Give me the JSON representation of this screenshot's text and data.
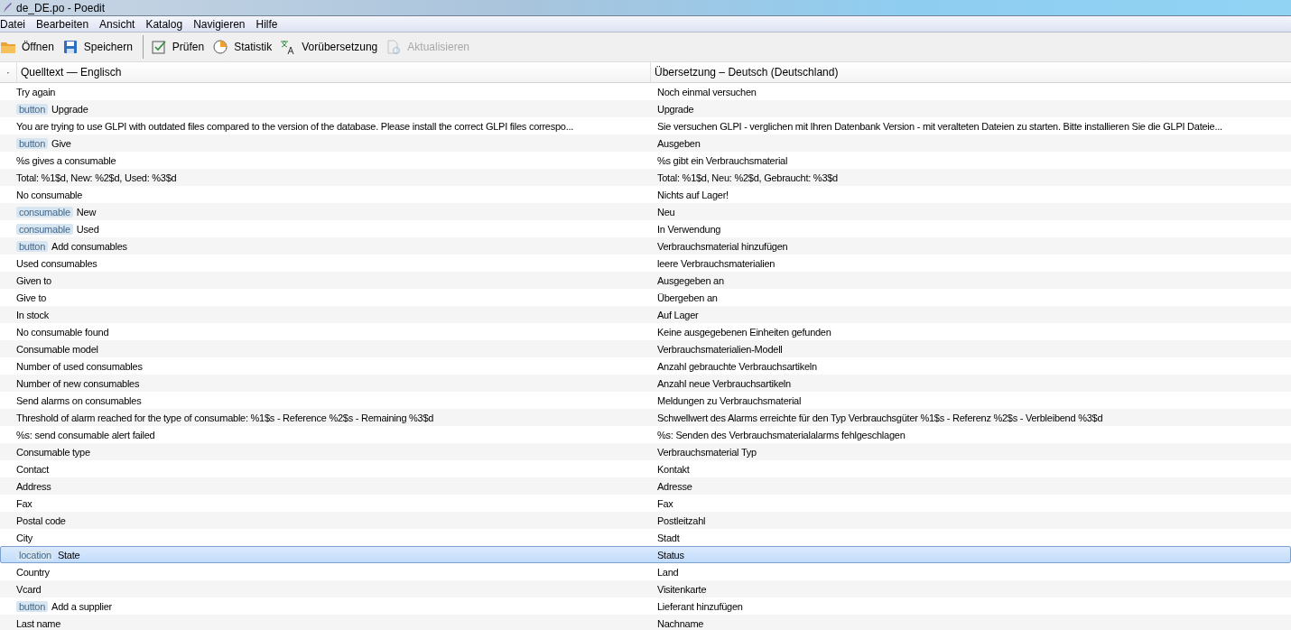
{
  "window": {
    "title": "de_DE.po - Poedit"
  },
  "menu": [
    "Datei",
    "Bearbeiten",
    "Ansicht",
    "Katalog",
    "Navigieren",
    "Hilfe"
  ],
  "toolbar": [
    {
      "kind": "open",
      "label": "Öffnen",
      "disabled": false
    },
    {
      "kind": "save",
      "label": "Speichern",
      "disabled": false
    },
    {
      "kind": "check",
      "label": "Prüfen",
      "disabled": false
    },
    {
      "kind": "stats",
      "label": "Statistik",
      "disabled": false
    },
    {
      "kind": "translate",
      "label": "Vorübersetzung",
      "disabled": false
    },
    {
      "kind": "update",
      "label": "Aktualisieren",
      "disabled": true
    }
  ],
  "table": {
    "marker": "·",
    "columns": [
      "Quelltext — Englisch",
      "Übersetzung – Deutsch (Deutschland)"
    ],
    "rows": [
      {
        "source": "Try again",
        "translation": "Noch einmal versuchen",
        "selected": false
      },
      {
        "context": "button",
        "source": "Upgrade",
        "translation": "Upgrade",
        "selected": false
      },
      {
        "source": "You are trying to use GLPI with outdated files compared to the version of the database. Please install the correct GLPI files correspo...",
        "translation": "Sie versuchen GLPI - verglichen mit Ihren Datenbank Version - mit veralteten Dateien zu starten. Bitte installieren Sie die GLPI Dateie...",
        "selected": false
      },
      {
        "context": "button",
        "source": "Give",
        "translation": "Ausgeben",
        "selected": false
      },
      {
        "source": "%s gives a consumable",
        "translation": "%s gibt ein Verbrauchsmaterial",
        "selected": false
      },
      {
        "source": "Total: %1$d, New: %2$d, Used: %3$d",
        "translation": "Total: %1$d, Neu: %2$d, Gebraucht: %3$d",
        "selected": false
      },
      {
        "source": "No consumable",
        "translation": "Nichts auf Lager!",
        "selected": false
      },
      {
        "context": "consumable",
        "source": "New",
        "translation": "Neu",
        "selected": false
      },
      {
        "context": "consumable",
        "source": "Used",
        "translation": "In Verwendung",
        "selected": false
      },
      {
        "context": "button",
        "source": "Add consumables",
        "translation": "Verbrauchsmaterial hinzufügen",
        "selected": false
      },
      {
        "source": "Used consumables",
        "translation": "leere Verbrauchsmaterialien",
        "selected": false
      },
      {
        "source": "Given to",
        "translation": "Ausgegeben an",
        "selected": false
      },
      {
        "source": "Give to",
        "translation": "Übergeben an",
        "selected": false
      },
      {
        "source": "In stock",
        "translation": "Auf Lager",
        "selected": false
      },
      {
        "source": "No consumable found",
        "translation": "Keine ausgegebenen Einheiten gefunden",
        "selected": false
      },
      {
        "source": "Consumable model",
        "translation": "Verbrauchsmaterialien-Modell",
        "selected": false
      },
      {
        "source": "Number of used consumables",
        "translation": "Anzahl gebrauchte Verbrauchsartikeln",
        "selected": false
      },
      {
        "source": "Number of new consumables",
        "translation": "Anzahl neue Verbrauchsartikeln",
        "selected": false
      },
      {
        "source": "Send alarms on consumables",
        "translation": "Meldungen zu Verbrauchsmaterial",
        "selected": false
      },
      {
        "source": "Threshold of alarm reached for the type of consumable: %1$s - Reference %2$s - Remaining %3$d",
        "translation": "Schwellwert des Alarms erreichte für den Typ Verbrauchsgüter %1$s - Referenz %2$s - Verbleibend %3$d",
        "selected": false
      },
      {
        "source": "%s: send consumable alert failed",
        "translation": "%s: Senden des Verbrauchsmaterialalarms fehlgeschlagen",
        "selected": false
      },
      {
        "source": "Consumable type",
        "translation": "Verbrauchsmaterial Typ",
        "selected": false
      },
      {
        "source": "Contact",
        "translation": "Kontakt",
        "selected": false
      },
      {
        "source": "Address",
        "translation": "Adresse",
        "selected": false
      },
      {
        "source": "Fax",
        "translation": "Fax",
        "selected": false
      },
      {
        "source": "Postal code",
        "translation": "Postleitzahl",
        "selected": false
      },
      {
        "source": "City",
        "translation": "Stadt",
        "selected": false
      },
      {
        "context": "location",
        "source": "State",
        "translation": "Status",
        "selected": true
      },
      {
        "source": "Country",
        "translation": "Land",
        "selected": false
      },
      {
        "source": "Vcard",
        "translation": "Visitenkarte",
        "selected": false
      },
      {
        "context": "button",
        "source": "Add a supplier",
        "translation": "Lieferant hinzufügen",
        "selected": false
      },
      {
        "source": "Last name",
        "translation": "Nachname",
        "selected": false
      }
    ]
  }
}
